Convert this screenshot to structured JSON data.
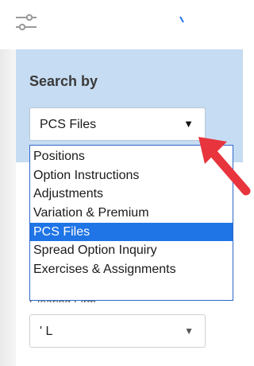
{
  "toolbar": {
    "filter_icon": "sliders-icon"
  },
  "search_panel": {
    "title": "Search by",
    "selected_value": "PCS Files",
    "options": [
      "Positions",
      "Option Instructions",
      "Adjustments",
      "Variation & Premium",
      "PCS Files",
      "Spread Option Inquiry",
      "Exercises & Assignments"
    ],
    "selected_index": 4
  },
  "clearing_firm": {
    "label": "Clearing Firm",
    "value": "' L"
  },
  "colors": {
    "panel_background": "#c6dcf2",
    "highlight": "#1f74e6",
    "arrow": "#e8343d"
  }
}
